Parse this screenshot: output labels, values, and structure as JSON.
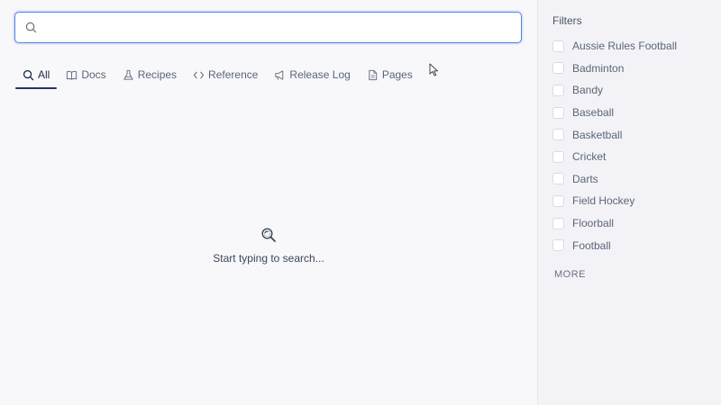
{
  "search": {
    "placeholder": "",
    "value": ""
  },
  "tabs": [
    {
      "label": "All",
      "icon": "search-icon",
      "active": true
    },
    {
      "label": "Docs",
      "icon": "book-icon",
      "active": false
    },
    {
      "label": "Recipes",
      "icon": "flask-icon",
      "active": false
    },
    {
      "label": "Reference",
      "icon": "code-icon",
      "active": false
    },
    {
      "label": "Release Log",
      "icon": "megaphone-icon",
      "active": false
    },
    {
      "label": "Pages",
      "icon": "page-icon",
      "active": false
    }
  ],
  "empty_state": {
    "icon": "magnify-icon",
    "text": "Start typing to search..."
  },
  "sidebar": {
    "title": "Filters",
    "items": [
      {
        "label": "Aussie Rules Football",
        "checked": false
      },
      {
        "label": "Badminton",
        "checked": false
      },
      {
        "label": "Bandy",
        "checked": false
      },
      {
        "label": "Baseball",
        "checked": false
      },
      {
        "label": "Basketball",
        "checked": false
      },
      {
        "label": "Cricket",
        "checked": false
      },
      {
        "label": "Darts",
        "checked": false
      },
      {
        "label": "Field Hockey",
        "checked": false
      },
      {
        "label": "Floorball",
        "checked": false
      },
      {
        "label": "Football",
        "checked": false
      }
    ],
    "more_label": "MORE"
  },
  "colors": {
    "accent": "#25326e",
    "focus_border": "#4f7fe0"
  }
}
